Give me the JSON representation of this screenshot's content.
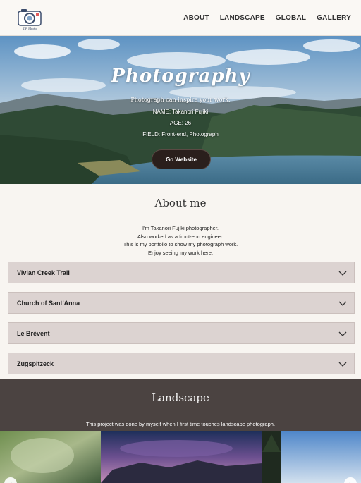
{
  "header": {
    "logo_text": "T.F. Photo",
    "nav": [
      "ABOUT",
      "LANDSCAPE",
      "GLOBAL",
      "GALLERY"
    ]
  },
  "hero": {
    "title": "Photography",
    "tagline": "Photograph can inspire your work.",
    "name": "NAME: Takanori Fujiki",
    "age": "AGE: 26",
    "field": "FIELD: Front-end, Photograph",
    "button": "Go Website"
  },
  "about": {
    "title": "About me",
    "lines": [
      "I'm Takanori Fujiki photographer.",
      "Also worked as a front-end engineer.",
      "This is my portfolio to show my photograph work.",
      "Enjoy seeing my work here."
    ],
    "accordion": [
      "Vivian Creek Trail",
      "Church of Sant'Anna",
      "Le Brévent",
      "Zugspitzeck"
    ]
  },
  "landscape": {
    "title": "Landscape",
    "text": "This project was done by myself when I first time touches landscape photograph."
  },
  "colors": {
    "accent_dark": "#2a1f1c",
    "accordion_bg": "#dcd3d1",
    "landscape_bg": "#4b4341"
  }
}
